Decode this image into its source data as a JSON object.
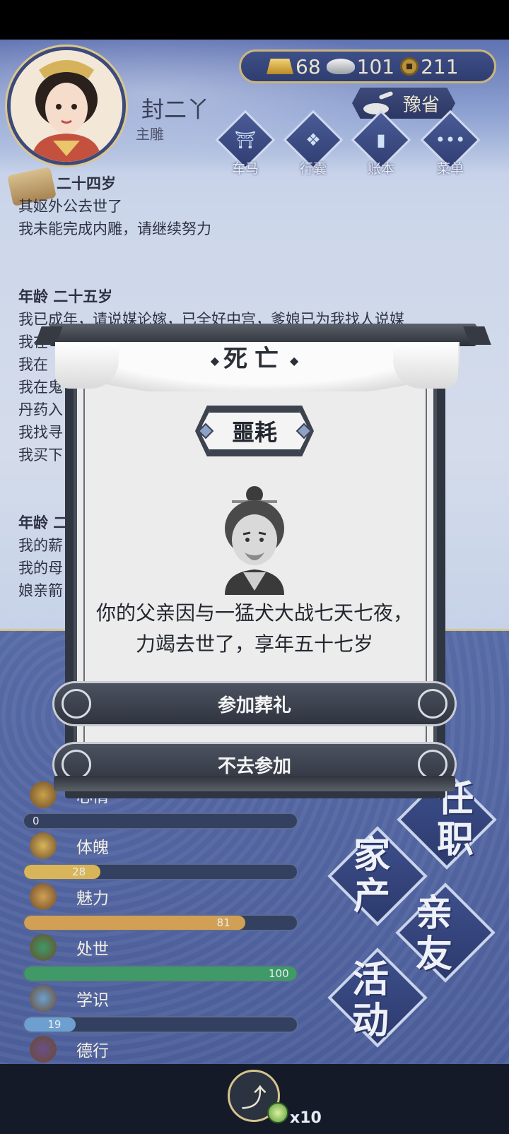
{
  "header": {
    "player_name": "封二丫",
    "player_title": "主雕",
    "currency": {
      "gold": "68",
      "silver": "101",
      "coin": "211"
    },
    "region": "豫省",
    "menu": [
      {
        "label": "车马",
        "icon": "carriage-icon"
      },
      {
        "label": "行囊",
        "icon": "bundle-icon"
      },
      {
        "label": "账本",
        "icon": "ledger-icon"
      },
      {
        "label": "菜单",
        "icon": "more-icon"
      }
    ]
  },
  "log": {
    "blocks": [
      {
        "age": "二十四岁",
        "lines": [
          "其妪外公去世了",
          "我未能完成内雕，请继续努力"
        ]
      },
      {
        "age": "年龄 二十五岁",
        "lines": [
          "我已成年，请说媒论嫁，已全好中宫，爹娘已为我找人说媒",
          "我在",
          "我在",
          "我在鬼",
          "丹药入",
          "我找寻",
          "我买下"
        ]
      },
      {
        "age": "年龄 二",
        "lines": [
          "我的薪",
          "我的母",
          "娘亲箭"
        ]
      }
    ],
    "trailing_mark": "!"
  },
  "stats": [
    {
      "label": "心情",
      "value": 0,
      "max": 100,
      "color": "#c9a24a",
      "icon": "flower-icon"
    },
    {
      "label": "体魄",
      "value": 28,
      "max": 100,
      "color": "#d9b55a",
      "icon": "body-icon"
    },
    {
      "label": "魅力",
      "value": 81,
      "max": 100,
      "color": "#d1a054",
      "icon": "charm-icon"
    },
    {
      "label": "处世",
      "value": 100,
      "max": 100,
      "color": "#3f9a67",
      "icon": "worldly-icon"
    },
    {
      "label": "学识",
      "value": 19,
      "max": 100,
      "color": "#6da0d0",
      "icon": "knowledge-icon"
    },
    {
      "label": "德行",
      "value": "",
      "max": 100,
      "color": "#6a4f8a",
      "icon": "virtue-icon"
    }
  ],
  "side_menu": [
    {
      "label": "任职"
    },
    {
      "label": "家产"
    },
    {
      "label": "亲友"
    },
    {
      "label": "活动"
    }
  ],
  "bottom": {
    "share_count": "x10"
  },
  "modal": {
    "title": "死亡",
    "badge": "噩耗",
    "message": "你的父亲因与一猛犬大战七天七夜，力竭去世了，享年五十七岁",
    "buttons": {
      "attend": "参加葬礼",
      "skip": "不去参加"
    }
  },
  "colors": {
    "accent_gold": "#d6c38b",
    "panel_blue": "#4c5e9a",
    "modal_dark": "#303641"
  }
}
